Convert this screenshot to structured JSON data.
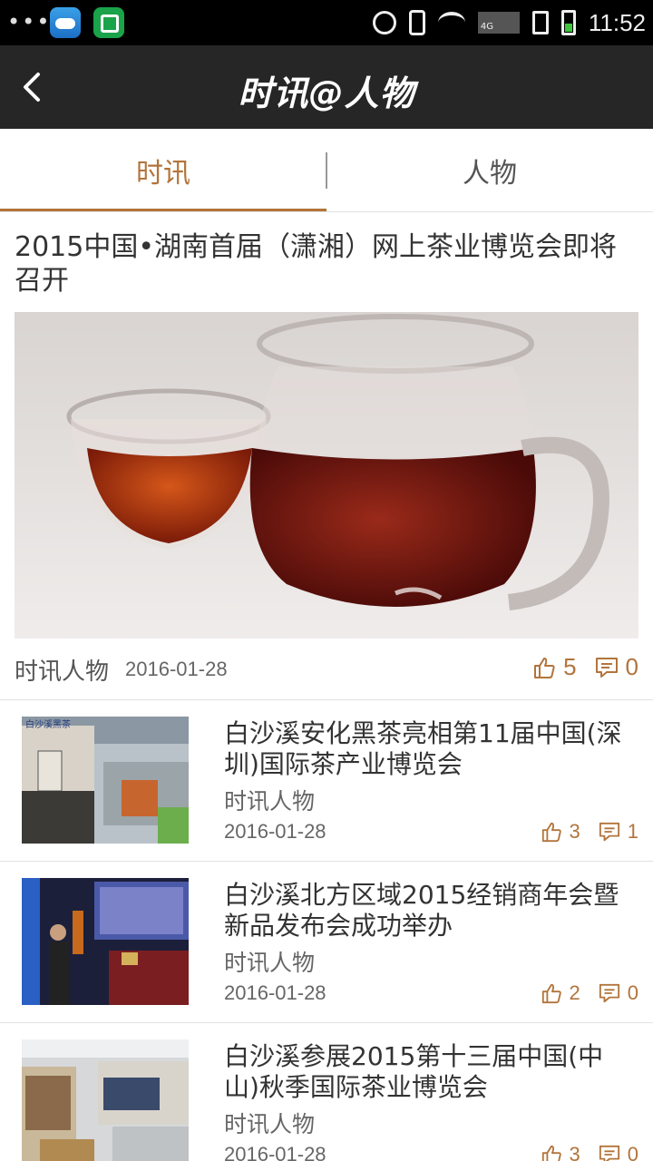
{
  "status_bar": {
    "time": "11:52",
    "network": "4G"
  },
  "header": {
    "title": "时讯@人物",
    "back_icon": "chevron-left-icon"
  },
  "tabs": [
    {
      "label": "时讯",
      "active": true
    },
    {
      "label": "人物",
      "active": false
    }
  ],
  "featured": {
    "title": "2015中国•湖南首届（潇湘）网上茶业博览会即将召开",
    "source": "时讯人物",
    "date": "2016-01-28",
    "likes": "5",
    "comments": "0"
  },
  "items": [
    {
      "title": "白沙溪安化黑茶亮相第11届中国(深圳)国际茶产业博览会",
      "source": "时讯人物",
      "date": "2016-01-28",
      "likes": "3",
      "comments": "1"
    },
    {
      "title": "白沙溪北方区域2015经销商年会暨新品发布会成功举办",
      "source": "时讯人物",
      "date": "2016-01-28",
      "likes": "2",
      "comments": "0"
    },
    {
      "title": "白沙溪参展2015第十三届中国(中山)秋季国际茶业博览会",
      "source": "时讯人物",
      "date": "2016-01-28",
      "likes": "3",
      "comments": "0"
    }
  ],
  "colors": {
    "accent": "#b2743b",
    "header_bg": "#262626",
    "status_bg": "#000000"
  }
}
